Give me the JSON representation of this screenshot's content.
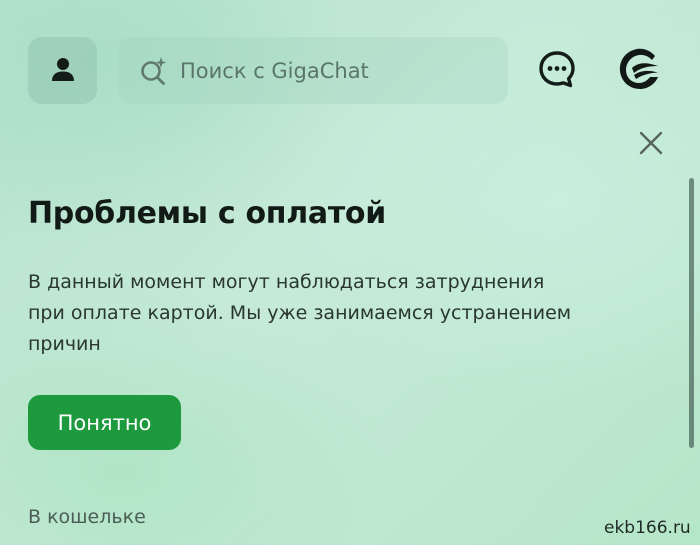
{
  "header": {
    "search": {
      "placeholder": "Поиск с GigaChat",
      "value": ""
    },
    "icons": {
      "profile": "person-icon",
      "search": "sparkle-search-icon",
      "chat": "chat-bubble-icon",
      "logo": "sber-wave-logo-icon"
    }
  },
  "notice": {
    "title": "Проблемы с оплатой",
    "message": "В данный момент могут наблюдаться затруднения\nпри оплате картой. Мы уже занимаемся устранением\nпричин",
    "primary_button": "Понятно",
    "close_icon": "close-icon"
  },
  "footer": {
    "wallet_link": "В кошельке"
  },
  "watermark": "ekb166.ru",
  "colors": {
    "accent": "#1e9a3e",
    "text_primary": "#121a17",
    "text_secondary": "#2a3631",
    "muted": "#4a5e56"
  }
}
